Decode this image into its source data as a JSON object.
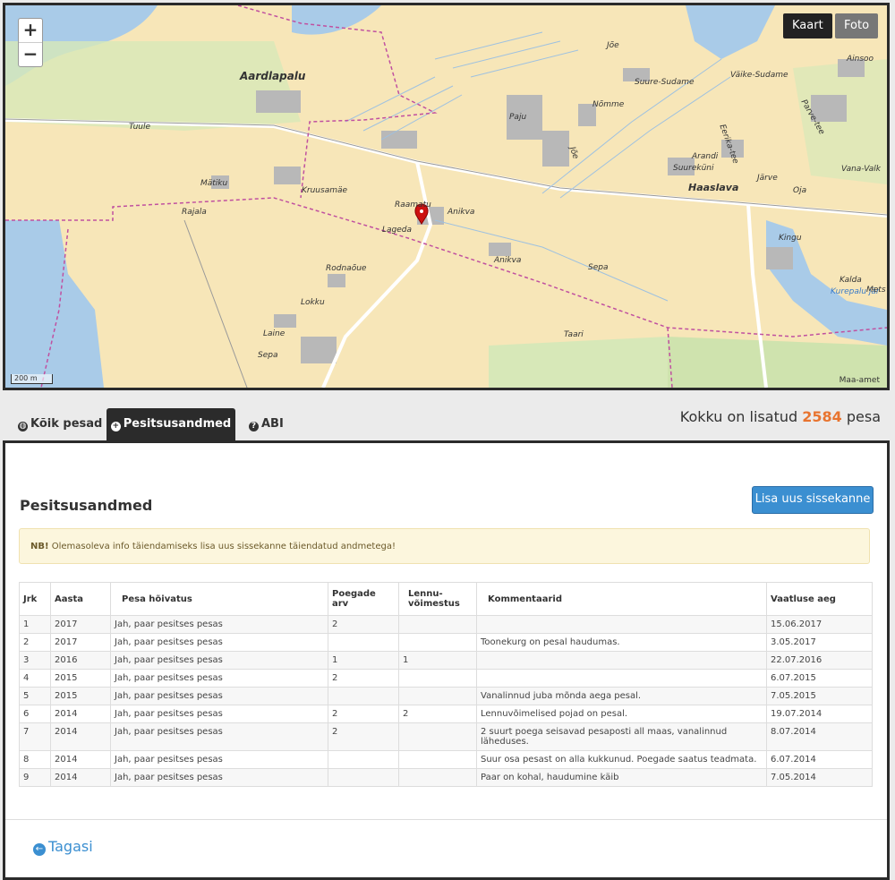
{
  "map": {
    "zoom_in": "+",
    "zoom_out": "−",
    "layer_kaart": "Kaart",
    "layer_foto": "Foto",
    "scale": "200 m",
    "attribution": "Maa-amet",
    "labels": [
      "Aardlapalu",
      "Tuule",
      "Mätiku",
      "Rajala",
      "Kruusamäe",
      "Raamatu",
      "Lageda",
      "Anikva",
      "Anikva",
      "Rodnaõue",
      "Lokku",
      "Laine",
      "Sepa",
      "Sepa",
      "Taari",
      "Haaslava",
      "Paju",
      "Jõe",
      "Nõmme",
      "Suure-Sudame",
      "Väike-Sudame",
      "Ainsoo",
      "Parve-tee",
      "Eerika-tee",
      "Arandi",
      "Suureküni",
      "Järve",
      "Oja",
      "Vana-Valk",
      "Kingu",
      "Kurepalu jär",
      "Kalda",
      "Mets",
      "Jõe"
    ],
    "colors": {
      "land": "#f7e6b8",
      "water": "#a9cbe8",
      "green": "#d7e8b8",
      "building": "#b8b8b8",
      "road": "#ffffff",
      "boundary": "#c050a0",
      "marker": "#cc1111"
    }
  },
  "tabs": [
    {
      "icon": "globe-icon",
      "label": "Kõik pesad"
    },
    {
      "icon": "plus-circle-icon",
      "label": "Pesitsusandmed"
    },
    {
      "icon": "question-circle-icon",
      "label": "ABI"
    }
  ],
  "total": {
    "prefix": "Kokku on lisatud",
    "count": "2584",
    "suffix": "pesa"
  },
  "panel": {
    "title": "Pesitsusandmed",
    "add_button": "Lisa uus sissekanne",
    "alert_bold": "NB!",
    "alert_text": "Olemasoleva info täiendamiseks lisa uus sissekanne täiendatud andmetega!",
    "back_label": "Tagasi",
    "headers": {
      "jrk": "Jrk",
      "aasta": "Aasta",
      "hoivatus": "Pesa hõivatus",
      "poegade": "Poegade arv",
      "lennu": "Lennu-võimestus",
      "komm": "Kommentaarid",
      "aeg": "Vaatluse aeg"
    },
    "rows": [
      {
        "jrk": "1",
        "aasta": "2017",
        "hoivatus": "Jah, paar pesitses pesas",
        "poegade": "2",
        "lennu": "",
        "komm": "",
        "aeg": "15.06.2017"
      },
      {
        "jrk": "2",
        "aasta": "2017",
        "hoivatus": "Jah, paar pesitses pesas",
        "poegade": "",
        "lennu": "",
        "komm": "Toonekurg on pesal haudumas.",
        "aeg": "3.05.2017"
      },
      {
        "jrk": "3",
        "aasta": "2016",
        "hoivatus": "Jah, paar pesitses pesas",
        "poegade": "1",
        "lennu": "1",
        "komm": "",
        "aeg": "22.07.2016"
      },
      {
        "jrk": "4",
        "aasta": "2015",
        "hoivatus": "Jah, paar pesitses pesas",
        "poegade": "2",
        "lennu": "",
        "komm": "",
        "aeg": "6.07.2015"
      },
      {
        "jrk": "5",
        "aasta": "2015",
        "hoivatus": "Jah, paar pesitses pesas",
        "poegade": "",
        "lennu": "",
        "komm": "Vanalinnud juba mõnda aega pesal.",
        "aeg": "7.05.2015"
      },
      {
        "jrk": "6",
        "aasta": "2014",
        "hoivatus": "Jah, paar pesitses pesas",
        "poegade": "2",
        "lennu": "2",
        "komm": "Lennuvõimelised pojad on pesal.",
        "aeg": "19.07.2014"
      },
      {
        "jrk": "7",
        "aasta": "2014",
        "hoivatus": "Jah, paar pesitses pesas",
        "poegade": "2",
        "lennu": "",
        "komm": "2 suurt poega seisavad pesaposti all maas, vanalinnud läheduses.",
        "aeg": "8.07.2014"
      },
      {
        "jrk": "8",
        "aasta": "2014",
        "hoivatus": "Jah, paar pesitses pesas",
        "poegade": "",
        "lennu": "",
        "komm": "Suur osa pesast on alla kukkunud. Poegade saatus teadmata.",
        "aeg": "6.07.2014"
      },
      {
        "jrk": "9",
        "aasta": "2014",
        "hoivatus": "Jah, paar pesitses pesas",
        "poegade": "",
        "lennu": "",
        "komm": "Paar on kohal, haudumine käib",
        "aeg": "7.05.2014"
      }
    ]
  }
}
